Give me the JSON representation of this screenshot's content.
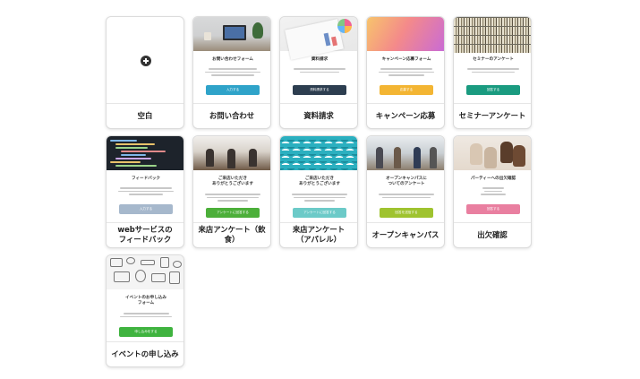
{
  "cards": [
    {
      "label": "空白",
      "form_title": "",
      "button": ""
    },
    {
      "label": "お問い合わせ",
      "form_title": "お問い合わせフォーム",
      "button": "入力する"
    },
    {
      "label": "資料請求",
      "form_title": "資料請求",
      "button": "資料請求する"
    },
    {
      "label": "キャンペーン応募",
      "form_title": "キャンペーン応募フォーム",
      "button": "応募する"
    },
    {
      "label": "セミナーアンケート",
      "form_title": "セミナーのアンケート",
      "button": "回答する"
    },
    {
      "label": "webサービスの\nフィードバック",
      "form_title": "フィードバック",
      "button": "入力する"
    },
    {
      "label": "来店アンケート（飲食）",
      "form_title": "ご来店いただき\nありがとうございます",
      "button": "アンケートに回答する"
    },
    {
      "label": "来店アンケート\n（アパレル）",
      "form_title": "ご来店いただき\nありがとうございます",
      "button": "アンケートに回答する"
    },
    {
      "label": "オープンキャンパス",
      "form_title": "オープンキャンパスに\nついてのアンケート",
      "button": "回答を送信する"
    },
    {
      "label": "出欠確認",
      "form_title": "パーティーへの出欠確認",
      "button": "回答する"
    },
    {
      "label": "イベントの申し込み",
      "form_title": "イベントのお申し込み\nフォーム",
      "button": "申し込みをする"
    }
  ],
  "colors": {
    "contact": "#2fa3c9",
    "docs": "#2d3e50",
    "campaign": "#f3b533",
    "seminar": "#1a9b80",
    "feedback": "#a6b8cc",
    "cafe": "#4caf3a",
    "apparel": "#6ccac8",
    "campus": "#9fc32f",
    "party": "#e97fa0",
    "event": "#3fb33f"
  }
}
